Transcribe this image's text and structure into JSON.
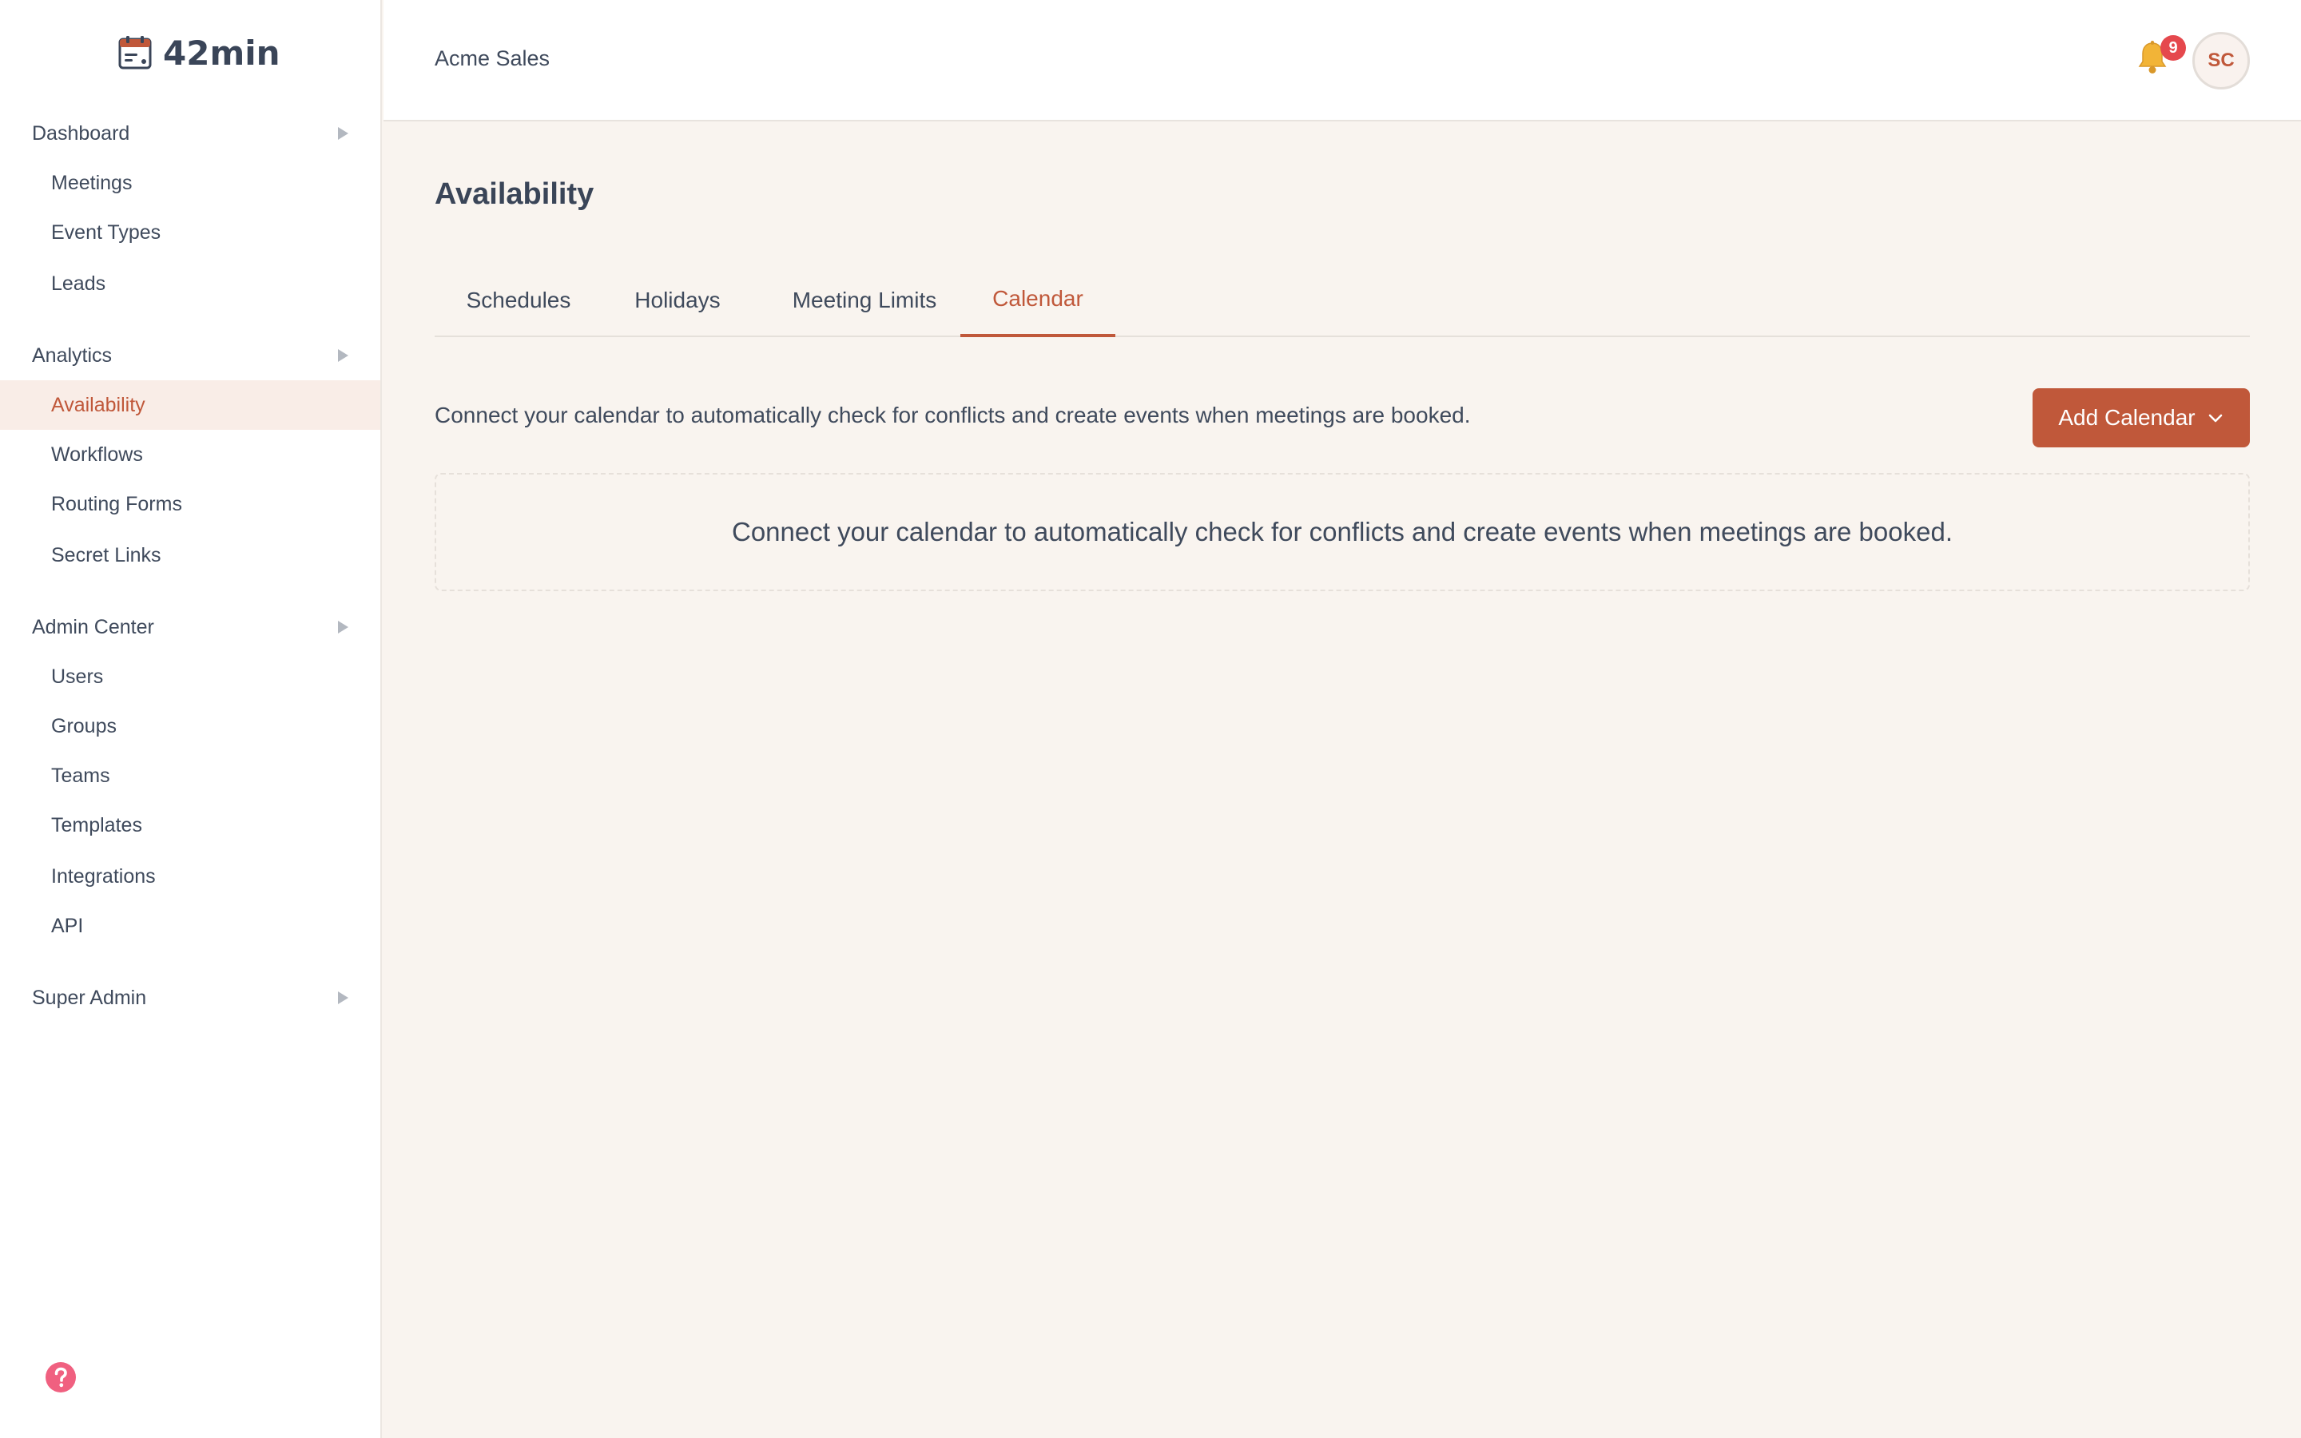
{
  "app": {
    "logo_text": "42min"
  },
  "sidebar": {
    "sections": [
      {
        "label": "Dashboard",
        "items": [
          {
            "label": "Meetings"
          },
          {
            "label": "Event Types"
          },
          {
            "label": "Leads"
          }
        ]
      },
      {
        "label": "Analytics",
        "items": [
          {
            "label": "Availability",
            "active": true
          },
          {
            "label": "Workflows"
          },
          {
            "label": "Routing Forms"
          },
          {
            "label": "Secret Links"
          }
        ]
      },
      {
        "label": "Admin Center",
        "items": [
          {
            "label": "Users"
          },
          {
            "label": "Groups"
          },
          {
            "label": "Teams"
          },
          {
            "label": "Templates"
          },
          {
            "label": "Integrations"
          },
          {
            "label": "API"
          }
        ]
      },
      {
        "label": "Super Admin",
        "items": []
      }
    ]
  },
  "header": {
    "org_name": "Acme Sales",
    "notification_count": "9",
    "avatar_initials": "SC"
  },
  "main": {
    "title": "Availability",
    "tabs": [
      {
        "label": "Schedules"
      },
      {
        "label": "Holidays"
      },
      {
        "label": "Meeting Limits"
      },
      {
        "label": "Calendar",
        "active": true
      }
    ],
    "intro_text": "Connect your calendar to automatically check for conflicts and create events when meetings are booked.",
    "add_button_label": "Add Calendar",
    "empty_state_text": "Connect your calendar to automatically check for conflicts and create events when meetings are booked."
  },
  "colors": {
    "accent": "#c0583a",
    "active_bg": "#f9ede7",
    "page_bg": "#f9f4ef",
    "badge": "#e5484d",
    "help": "#f06080"
  },
  "icons": {
    "logo": "calendar-icon",
    "section_arrow": "triangle-right-icon",
    "notifications": "bell-icon",
    "button_chevron": "chevron-down-icon",
    "help": "help-circle-icon"
  }
}
